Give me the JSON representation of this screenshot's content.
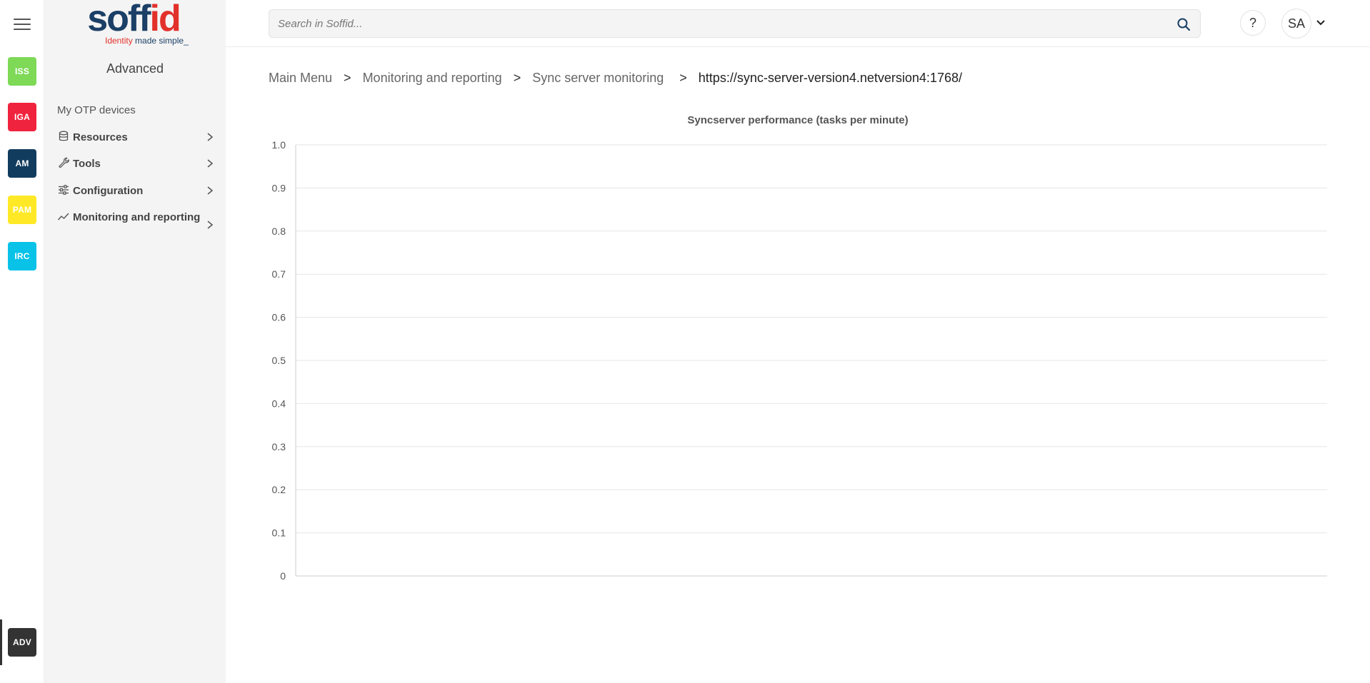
{
  "rail": {
    "modules": [
      {
        "label": "ISS",
        "color": "#7ed957"
      },
      {
        "label": "IGA",
        "color": "#f0233e"
      },
      {
        "label": "AM",
        "color": "#113c5e"
      },
      {
        "label": "PAM",
        "color": "#ffe926"
      },
      {
        "label": "IRC",
        "color": "#08c2e8"
      }
    ],
    "active_module": {
      "label": "ADV",
      "color": "#333333"
    }
  },
  "sidebar": {
    "logo": {
      "word_a": "soff",
      "word_b": "id",
      "tagline_a": "Identity",
      "tagline_b": " made simple_"
    },
    "heading": "Advanced",
    "items": [
      {
        "label": "My OTP devices",
        "icon": "none"
      },
      {
        "label": "Resources",
        "icon": "database-icon"
      },
      {
        "label": "Tools",
        "icon": "wrench-icon"
      },
      {
        "label": "Configuration",
        "icon": "sliders-icon"
      },
      {
        "label": "Monitoring and reporting",
        "icon": "trend-icon"
      }
    ]
  },
  "topbar": {
    "search_placeholder": "Search in Soffid...",
    "help_label": "?",
    "avatar_initials": "SA"
  },
  "breadcrumb": {
    "items": [
      "Main Menu",
      "Monitoring and reporting",
      "Sync server monitoring",
      "https://sync-server-version4.netversion4:1768/"
    ],
    "separator": ">"
  },
  "chart_data": {
    "type": "line",
    "title": "Syncserver performance (tasks per minute)",
    "xlabel": "",
    "ylabel": "",
    "ylim": [
      0,
      1
    ],
    "y_ticks": [
      "0",
      "0.1",
      "0.2",
      "0.3",
      "0.4",
      "0.5",
      "0.6",
      "0.7",
      "0.8",
      "0.9",
      "1.0"
    ],
    "series": [],
    "grid": true,
    "colors": {
      "grid": "#e6e6e6",
      "axis": "#cccccc",
      "tick_text": "#555555"
    }
  }
}
